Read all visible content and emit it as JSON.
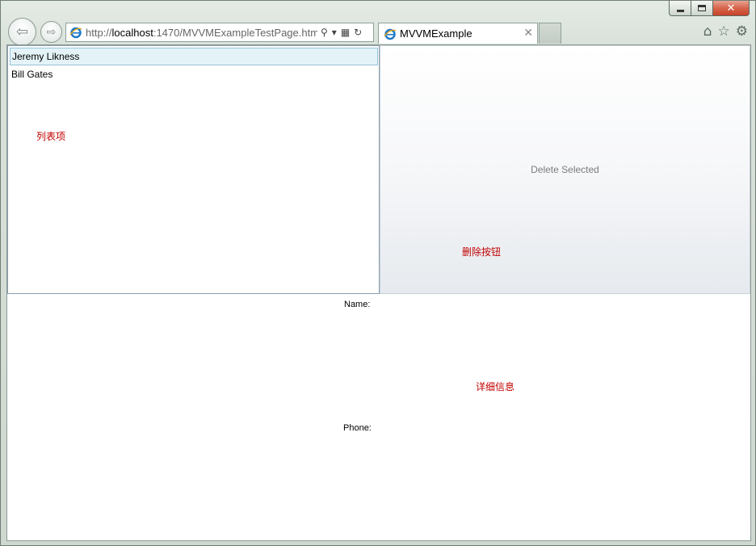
{
  "browser": {
    "url_prefix": "http://",
    "url_host": "localhost",
    "url_rest": ":1470/MVVMExampleTestPage.htm",
    "tab_title": "MVVMExample",
    "accent": "#1e78c8"
  },
  "list": {
    "items": [
      "Jeremy Likness",
      "Bill Gates"
    ],
    "selected_index": 0
  },
  "delete_button": {
    "label": "Delete Selected"
  },
  "details": {
    "name_label": "Name:",
    "phone_label": "Phone:"
  },
  "annotations": {
    "list": "列表项",
    "delete": "删除按钮",
    "details": "详细信息",
    "color": "#c00000"
  }
}
